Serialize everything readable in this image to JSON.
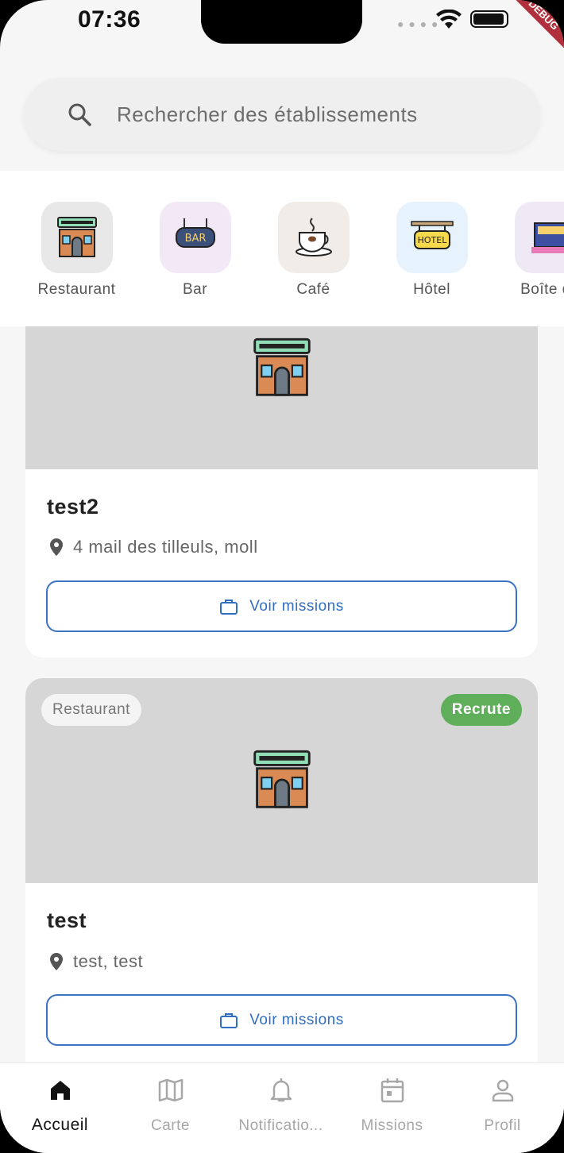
{
  "status_bar": {
    "time": "07:36",
    "debug_label": "DEBUG"
  },
  "search": {
    "placeholder": "Rechercher des établissements"
  },
  "categories": [
    {
      "label": "Restaurant",
      "icon": "restaurant-icon",
      "tile_color": "#e8e8e8"
    },
    {
      "label": "Bar",
      "icon": "bar-sign-icon",
      "tile_color": "#f3e9f6"
    },
    {
      "label": "Café",
      "icon": "coffee-cup-icon",
      "tile_color": "#f1ece8"
    },
    {
      "label": "Hôtel",
      "icon": "hotel-sign-icon",
      "tile_color": "#e6f2fc"
    },
    {
      "label": "Boîte de",
      "icon": "nightclub-icon",
      "tile_color": "#efe9f6"
    }
  ],
  "establishments": [
    {
      "name": "test2",
      "address": "4 mail des tilleuls, moll",
      "button_label": "Voir missions"
    },
    {
      "name": "test",
      "address": "test, test",
      "type_chip": "Restaurant",
      "status_chip": "Recrute",
      "button_label": "Voir missions"
    }
  ],
  "nav": [
    {
      "label": "Accueil",
      "icon": "home-icon",
      "active": true
    },
    {
      "label": "Carte",
      "icon": "map-icon",
      "active": false
    },
    {
      "label": "Notificatio...",
      "icon": "bell-icon",
      "active": false
    },
    {
      "label": "Missions",
      "icon": "calendar-icon",
      "active": false
    },
    {
      "label": "Profil",
      "icon": "person-icon",
      "active": false
    }
  ]
}
